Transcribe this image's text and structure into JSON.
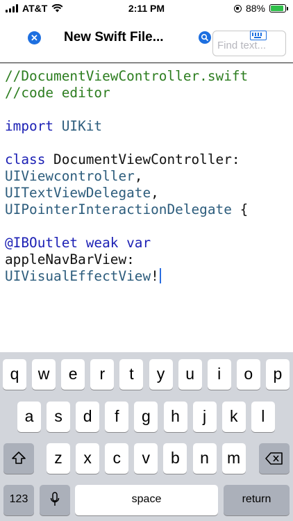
{
  "status_bar": {
    "carrier": "AT&T",
    "time": "2:11 PM",
    "battery_percent": "88%",
    "battery_level": 0.88
  },
  "nav": {
    "title": "New Swift File...",
    "find_placeholder": "Find text...",
    "accent_color": "#1d6fe0"
  },
  "editor": {
    "lines": [
      [
        {
          "t": "//DocumentViewController.swift",
          "k": "comment"
        }
      ],
      [
        {
          "t": "//code editor",
          "k": "comment"
        }
      ],
      [],
      [
        {
          "t": "import",
          "k": "kw"
        },
        {
          "t": " UIKit",
          "k": "type"
        }
      ],
      [],
      [
        {
          "t": "class",
          "k": "kw"
        },
        {
          "t": " DocumentViewController:",
          "k": "plain"
        }
      ],
      [
        {
          "t": "UIViewcontroller",
          "k": "type"
        },
        {
          "t": ",",
          "k": "plain"
        }
      ],
      [
        {
          "t": "UITextViewDelegate",
          "k": "type"
        },
        {
          "t": ",",
          "k": "plain"
        }
      ],
      [
        {
          "t": "UIPointerInteractionDelegate",
          "k": "type"
        },
        {
          "t": " {",
          "k": "plain"
        }
      ],
      [],
      [
        {
          "t": "@IBOutlet weak var",
          "k": "kw"
        }
      ],
      [
        {
          "t": "appleNavBarView:",
          "k": "plain"
        }
      ],
      [
        {
          "t": "UIVisualEffectView",
          "k": "type"
        },
        {
          "t": "!",
          "k": "plain"
        }
      ]
    ]
  },
  "keyboard": {
    "row1": [
      "q",
      "w",
      "e",
      "r",
      "t",
      "y",
      "u",
      "i",
      "o",
      "p"
    ],
    "row2": [
      "a",
      "s",
      "d",
      "f",
      "g",
      "h",
      "j",
      "k",
      "l"
    ],
    "row3": [
      "z",
      "x",
      "c",
      "v",
      "b",
      "n",
      "m"
    ],
    "numbers_key": "123",
    "space_key": "space",
    "return_key": "return"
  }
}
